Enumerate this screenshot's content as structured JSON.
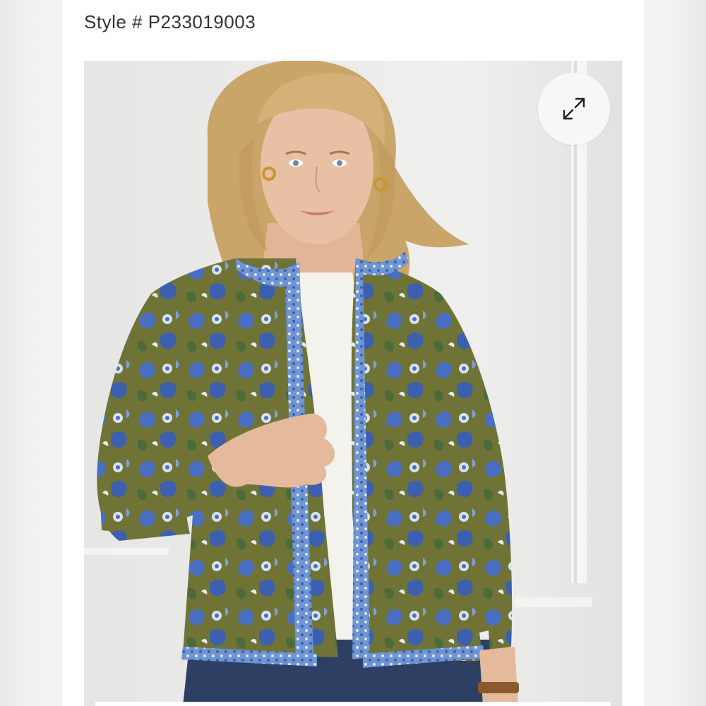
{
  "product": {
    "style_label": "Style # P233019003"
  },
  "image": {
    "description_icon": "product-photo",
    "colors": {
      "background": "#e4e4e2",
      "jacket_olive": "#6f7436",
      "jacket_blue": "#4a6fc2",
      "trim_blue": "#6f95d4",
      "hair": "#c9a56a",
      "skin": "#e8c0a4",
      "jeans": "#2d3f63"
    }
  },
  "controls": {
    "expand_icon": "expand-arrows-icon"
  }
}
